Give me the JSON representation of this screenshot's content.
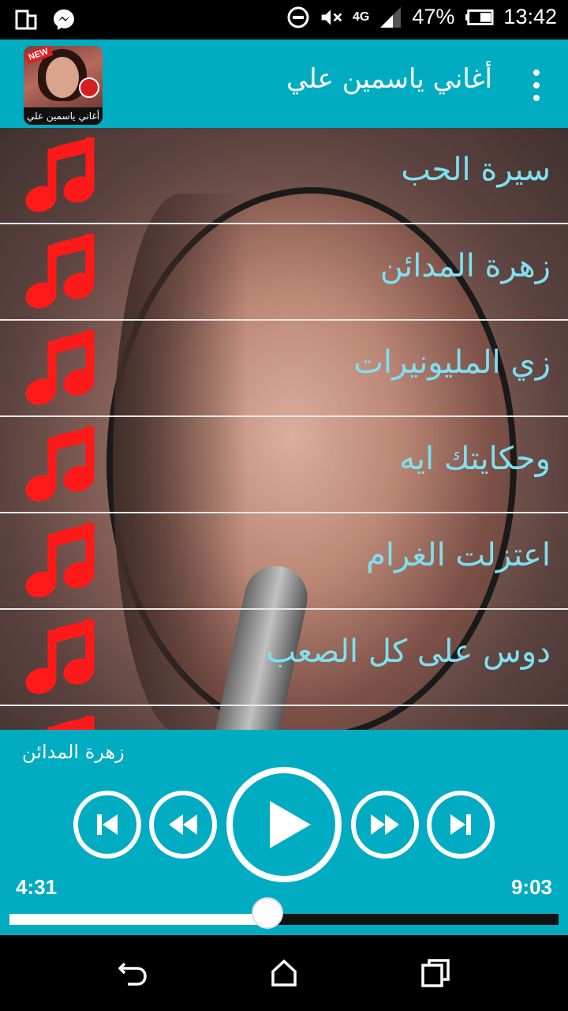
{
  "status_bar": {
    "icons": [
      "screen-rotate-icon",
      "messenger-icon",
      "do-not-disturb-icon",
      "mute-icon",
      "4g-signal-icon",
      "battery-icon"
    ],
    "network": "4G",
    "battery": "47%",
    "time": "13:42"
  },
  "app_bar": {
    "title": "أغاني  ياسمين علي",
    "logo_badge": "NEW",
    "logo_caption": "أغاني ياسمين علي"
  },
  "songs": [
    {
      "title": "سيرة الحب"
    },
    {
      "title": "زهرة المدائن"
    },
    {
      "title": "زي المليونيرات"
    },
    {
      "title": "وحكايتك ايه"
    },
    {
      "title": "اعتزلت الغرام"
    },
    {
      "title": "دوس على كل الصعب"
    }
  ],
  "player": {
    "now_playing": "زهرة المدائن",
    "current_time": "4:31",
    "total_time": "9:03",
    "progress": 0.5
  },
  "colors": {
    "accent": "#00acc1",
    "song_text": "#7fe0f0",
    "note": "#ff1a1a"
  }
}
